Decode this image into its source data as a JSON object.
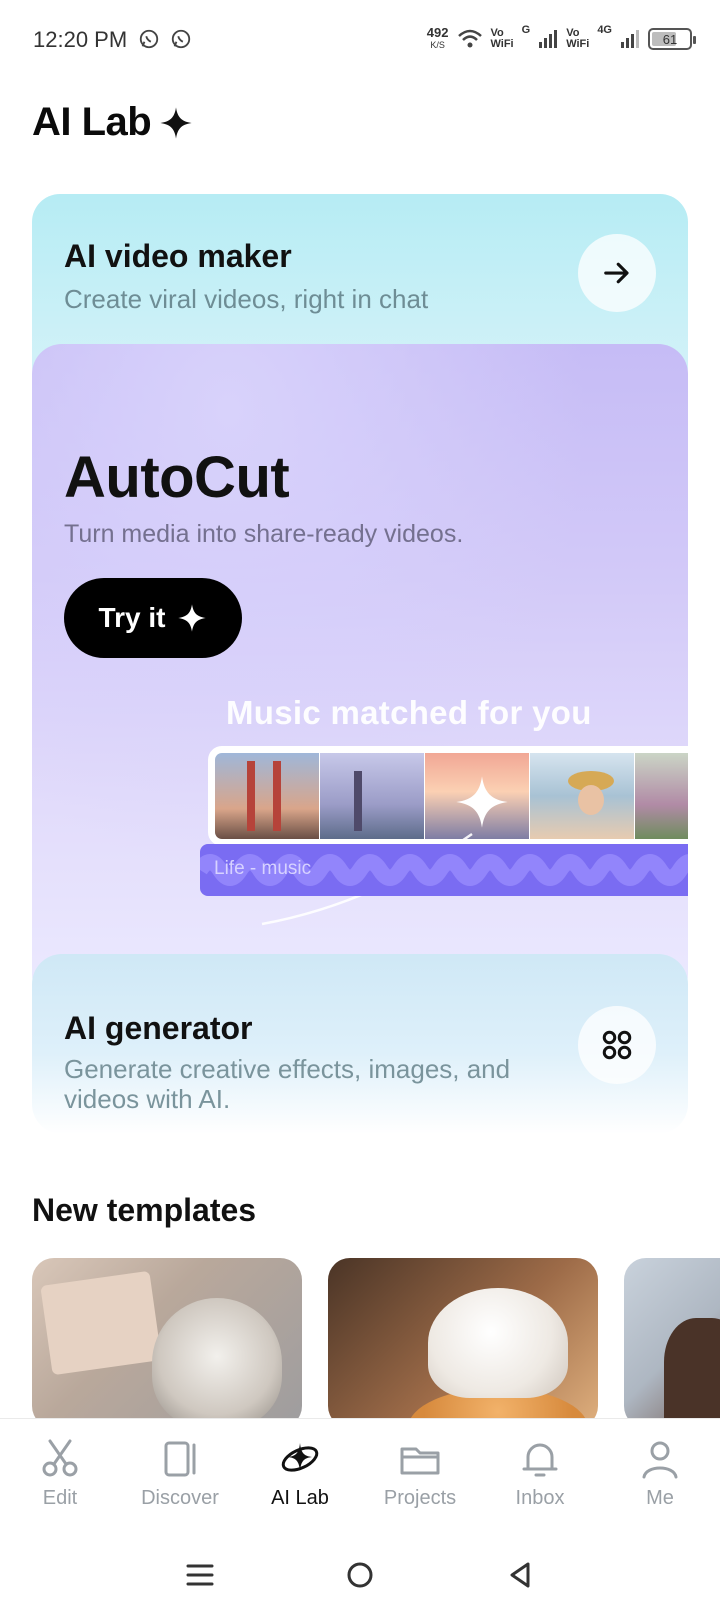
{
  "status_bar": {
    "time": "12:20 PM",
    "speed_value": "492",
    "speed_unit": "K/S",
    "vo1": "Vo",
    "wifi1": "WiFi",
    "net1": "G",
    "vo2": "Vo",
    "wifi2": "WiFi",
    "net2": "4G",
    "battery": "61"
  },
  "header": {
    "title": "AI Lab"
  },
  "video_maker": {
    "title": "AI video maker",
    "subtitle": "Create viral videos, right in chat"
  },
  "autocut": {
    "title": "AutoCut",
    "subtitle": "Turn media into share-ready videos.",
    "button_label": "Try it",
    "music_title": "Music matched for you",
    "audio_label": "Life - music"
  },
  "generator": {
    "title": "AI generator",
    "subtitle": "Generate creative effects, images, and videos with AI."
  },
  "templates": {
    "title": "New templates"
  },
  "nav": {
    "items": [
      {
        "label": "Edit",
        "icon": "scissors-icon"
      },
      {
        "label": "Discover",
        "icon": "discover-icon"
      },
      {
        "label": "AI Lab",
        "icon": "ai-lab-icon"
      },
      {
        "label": "Projects",
        "icon": "folder-icon"
      },
      {
        "label": "Inbox",
        "icon": "bell-icon"
      },
      {
        "label": "Me",
        "icon": "person-icon"
      }
    ],
    "active": "AI Lab"
  },
  "colors": {
    "accent": "#7a6cf2",
    "button_bg": "#000000"
  }
}
